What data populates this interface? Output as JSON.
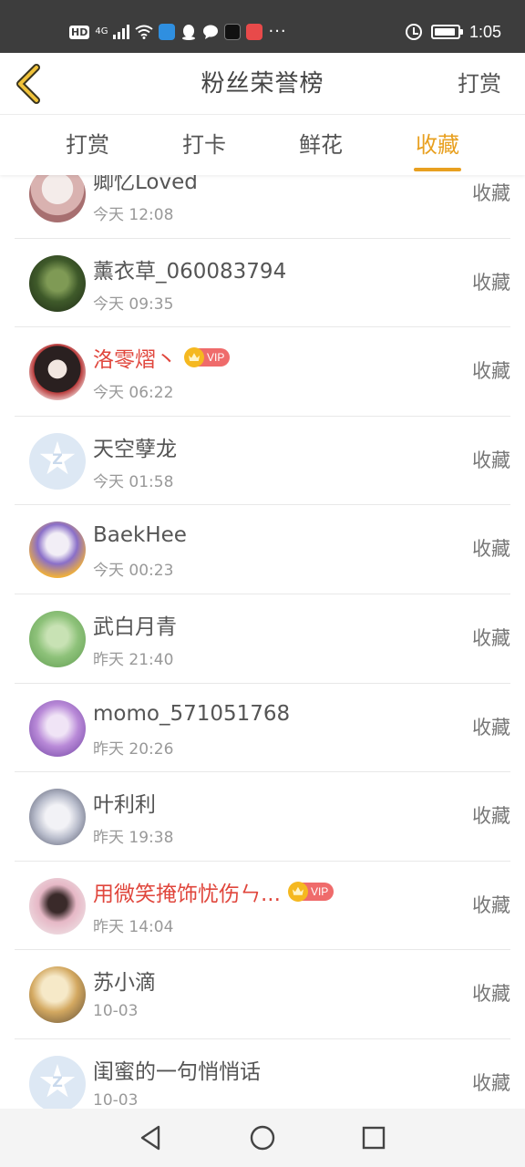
{
  "status_bar": {
    "hd_badge": "HD",
    "network": "4G",
    "time": "1:05",
    "overflow": "···",
    "app_icons": [
      "signal-icon",
      "wifi-icon",
      "browser-icon",
      "qq-icon",
      "chat-icon",
      "tiktok-icon",
      "reader-icon"
    ],
    "alarm_icon": "alarm-icon",
    "battery_icon": "battery-icon"
  },
  "header": {
    "title": "粉丝荣誉榜",
    "right_button": "打赏",
    "back_icon": "chevron-left-icon"
  },
  "colors": {
    "accent": "#e8a020",
    "vip_name": "#e0463c",
    "vip_badge": "#ef6b6b",
    "status_bar_bg": "#3d3d3d"
  },
  "tabs": [
    {
      "label": "打赏",
      "active": false
    },
    {
      "label": "打卡",
      "active": false
    },
    {
      "label": "鲜花",
      "active": false
    },
    {
      "label": "收藏",
      "active": true
    }
  ],
  "vip_label": "VIP",
  "fans": [
    {
      "name": "卿忆Loved",
      "time": "今天 12:08",
      "action": "收藏",
      "vip": false,
      "avatar": "anime-avatar"
    },
    {
      "name": "薰衣草_060083794",
      "time": "今天 09:35",
      "action": "收藏",
      "vip": false,
      "avatar": "photo-avatar"
    },
    {
      "name": "洛零熠丶",
      "time": "今天 06:22",
      "action": "收藏",
      "vip": true,
      "avatar": "anime-avatar"
    },
    {
      "name": "天空孽龙",
      "time": "今天 01:58",
      "action": "收藏",
      "vip": false,
      "avatar": "default-avatar"
    },
    {
      "name": "BaekHee",
      "time": "今天 00:23",
      "action": "收藏",
      "vip": false,
      "avatar": "anime-avatar"
    },
    {
      "name": "武白月青",
      "time": "昨天 21:40",
      "action": "收藏",
      "vip": false,
      "avatar": "anime-avatar"
    },
    {
      "name": "momo_571051768",
      "time": "昨天 20:26",
      "action": "收藏",
      "vip": false,
      "avatar": "anime-avatar"
    },
    {
      "name": "叶利利",
      "time": "昨天 19:38",
      "action": "收藏",
      "vip": false,
      "avatar": "anime-avatar"
    },
    {
      "name": "用微笑掩饰忧伤ㄣ...",
      "time": "昨天 14:04",
      "action": "收藏",
      "vip": true,
      "avatar": "photo-avatar"
    },
    {
      "name": "苏小滴",
      "time": "10-03",
      "action": "收藏",
      "vip": false,
      "avatar": "anime-avatar"
    },
    {
      "name": "闺蜜的一句悄悄话",
      "time": "10-03",
      "action": "收藏",
      "vip": false,
      "avatar": "default-avatar"
    }
  ],
  "nav_bar": {
    "back_icon": "triangle-back-icon",
    "home_icon": "circle-home-icon",
    "recent_icon": "square-recents-icon"
  }
}
